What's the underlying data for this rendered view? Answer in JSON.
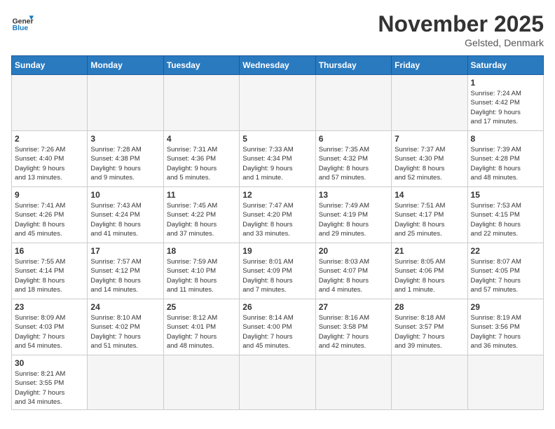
{
  "header": {
    "logo_general": "General",
    "logo_blue": "Blue",
    "title": "November 2025",
    "location": "Gelsted, Denmark"
  },
  "weekdays": [
    "Sunday",
    "Monday",
    "Tuesday",
    "Wednesday",
    "Thursday",
    "Friday",
    "Saturday"
  ],
  "weeks": [
    [
      {
        "day": "",
        "info": ""
      },
      {
        "day": "",
        "info": ""
      },
      {
        "day": "",
        "info": ""
      },
      {
        "day": "",
        "info": ""
      },
      {
        "day": "",
        "info": ""
      },
      {
        "day": "",
        "info": ""
      },
      {
        "day": "1",
        "info": "Sunrise: 7:24 AM\nSunset: 4:42 PM\nDaylight: 9 hours\nand 17 minutes."
      }
    ],
    [
      {
        "day": "2",
        "info": "Sunrise: 7:26 AM\nSunset: 4:40 PM\nDaylight: 9 hours\nand 13 minutes."
      },
      {
        "day": "3",
        "info": "Sunrise: 7:28 AM\nSunset: 4:38 PM\nDaylight: 9 hours\nand 9 minutes."
      },
      {
        "day": "4",
        "info": "Sunrise: 7:31 AM\nSunset: 4:36 PM\nDaylight: 9 hours\nand 5 minutes."
      },
      {
        "day": "5",
        "info": "Sunrise: 7:33 AM\nSunset: 4:34 PM\nDaylight: 9 hours\nand 1 minute."
      },
      {
        "day": "6",
        "info": "Sunrise: 7:35 AM\nSunset: 4:32 PM\nDaylight: 8 hours\nand 57 minutes."
      },
      {
        "day": "7",
        "info": "Sunrise: 7:37 AM\nSunset: 4:30 PM\nDaylight: 8 hours\nand 52 minutes."
      },
      {
        "day": "8",
        "info": "Sunrise: 7:39 AM\nSunset: 4:28 PM\nDaylight: 8 hours\nand 48 minutes."
      }
    ],
    [
      {
        "day": "9",
        "info": "Sunrise: 7:41 AM\nSunset: 4:26 PM\nDaylight: 8 hours\nand 45 minutes."
      },
      {
        "day": "10",
        "info": "Sunrise: 7:43 AM\nSunset: 4:24 PM\nDaylight: 8 hours\nand 41 minutes."
      },
      {
        "day": "11",
        "info": "Sunrise: 7:45 AM\nSunset: 4:22 PM\nDaylight: 8 hours\nand 37 minutes."
      },
      {
        "day": "12",
        "info": "Sunrise: 7:47 AM\nSunset: 4:20 PM\nDaylight: 8 hours\nand 33 minutes."
      },
      {
        "day": "13",
        "info": "Sunrise: 7:49 AM\nSunset: 4:19 PM\nDaylight: 8 hours\nand 29 minutes."
      },
      {
        "day": "14",
        "info": "Sunrise: 7:51 AM\nSunset: 4:17 PM\nDaylight: 8 hours\nand 25 minutes."
      },
      {
        "day": "15",
        "info": "Sunrise: 7:53 AM\nSunset: 4:15 PM\nDaylight: 8 hours\nand 22 minutes."
      }
    ],
    [
      {
        "day": "16",
        "info": "Sunrise: 7:55 AM\nSunset: 4:14 PM\nDaylight: 8 hours\nand 18 minutes."
      },
      {
        "day": "17",
        "info": "Sunrise: 7:57 AM\nSunset: 4:12 PM\nDaylight: 8 hours\nand 14 minutes."
      },
      {
        "day": "18",
        "info": "Sunrise: 7:59 AM\nSunset: 4:10 PM\nDaylight: 8 hours\nand 11 minutes."
      },
      {
        "day": "19",
        "info": "Sunrise: 8:01 AM\nSunset: 4:09 PM\nDaylight: 8 hours\nand 7 minutes."
      },
      {
        "day": "20",
        "info": "Sunrise: 8:03 AM\nSunset: 4:07 PM\nDaylight: 8 hours\nand 4 minutes."
      },
      {
        "day": "21",
        "info": "Sunrise: 8:05 AM\nSunset: 4:06 PM\nDaylight: 8 hours\nand 1 minute."
      },
      {
        "day": "22",
        "info": "Sunrise: 8:07 AM\nSunset: 4:05 PM\nDaylight: 7 hours\nand 57 minutes."
      }
    ],
    [
      {
        "day": "23",
        "info": "Sunrise: 8:09 AM\nSunset: 4:03 PM\nDaylight: 7 hours\nand 54 minutes."
      },
      {
        "day": "24",
        "info": "Sunrise: 8:10 AM\nSunset: 4:02 PM\nDaylight: 7 hours\nand 51 minutes."
      },
      {
        "day": "25",
        "info": "Sunrise: 8:12 AM\nSunset: 4:01 PM\nDaylight: 7 hours\nand 48 minutes."
      },
      {
        "day": "26",
        "info": "Sunrise: 8:14 AM\nSunset: 4:00 PM\nDaylight: 7 hours\nand 45 minutes."
      },
      {
        "day": "27",
        "info": "Sunrise: 8:16 AM\nSunset: 3:58 PM\nDaylight: 7 hours\nand 42 minutes."
      },
      {
        "day": "28",
        "info": "Sunrise: 8:18 AM\nSunset: 3:57 PM\nDaylight: 7 hours\nand 39 minutes."
      },
      {
        "day": "29",
        "info": "Sunrise: 8:19 AM\nSunset: 3:56 PM\nDaylight: 7 hours\nand 36 minutes."
      }
    ],
    [
      {
        "day": "30",
        "info": "Sunrise: 8:21 AM\nSunset: 3:55 PM\nDaylight: 7 hours\nand 34 minutes."
      },
      {
        "day": "",
        "info": ""
      },
      {
        "day": "",
        "info": ""
      },
      {
        "day": "",
        "info": ""
      },
      {
        "day": "",
        "info": ""
      },
      {
        "day": "",
        "info": ""
      },
      {
        "day": "",
        "info": ""
      }
    ]
  ]
}
